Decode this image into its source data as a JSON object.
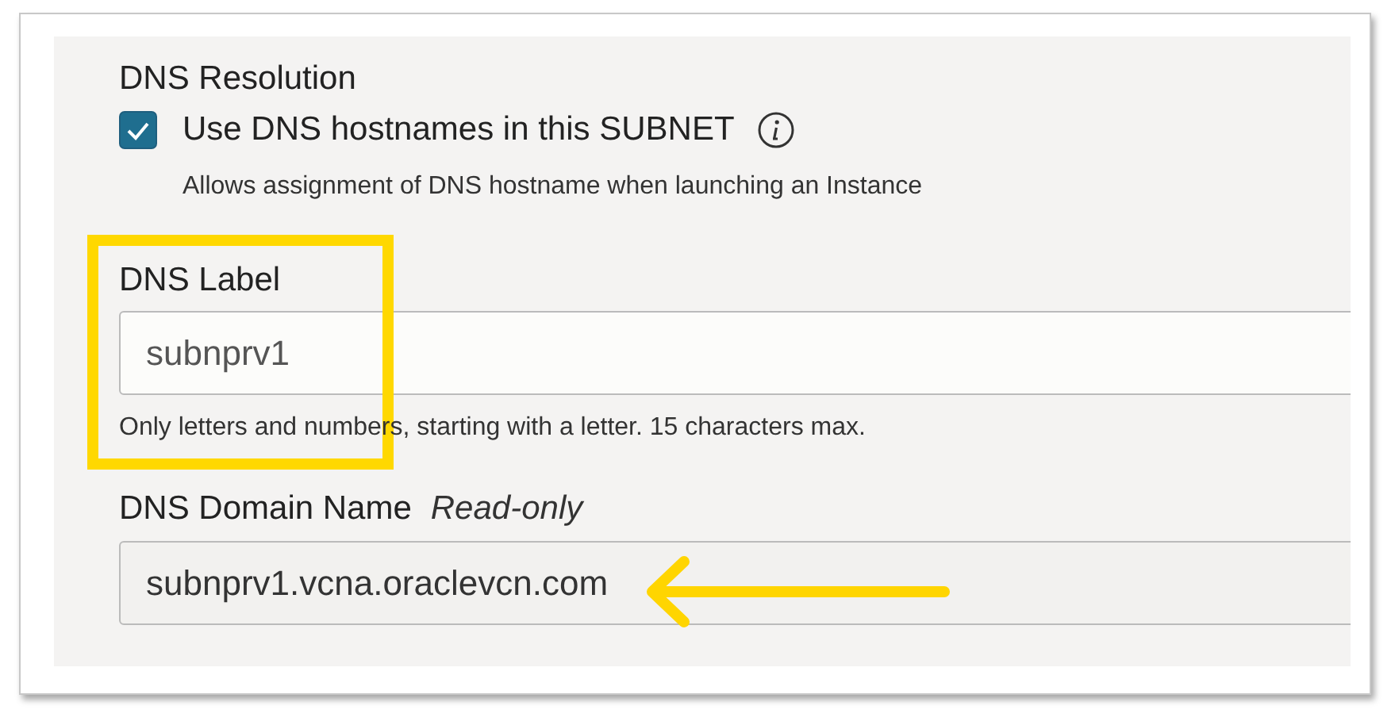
{
  "dns_resolution": {
    "title": "DNS Resolution",
    "checkbox": {
      "label": "Use DNS hostnames in this SUBNET",
      "checked": true,
      "info_icon": true
    },
    "help": "Allows assignment of DNS hostname when launching an Instance"
  },
  "dns_label": {
    "label": "DNS Label",
    "value": "subnprv1",
    "help": "Only letters and numbers, starting with a letter. 15 characters max."
  },
  "dns_domain_name": {
    "label": "DNS Domain Name",
    "note": "Read-only",
    "value": "subnprv1.vcna.oraclevcn.com"
  }
}
